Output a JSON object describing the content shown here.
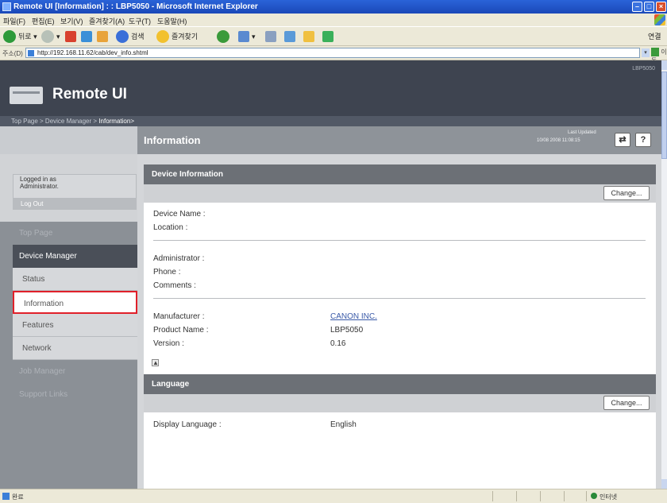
{
  "browser": {
    "title": "Remote UI [Information] : : LBP5050 - Microsoft Internet Explorer",
    "menu": [
      "파일(F)",
      "편집(E)",
      "보기(V)",
      "즐겨찾기(A)",
      "도구(T)",
      "도움말(H)"
    ],
    "toolbar": {
      "back_label": "뒤로",
      "search_label": "검색",
      "favorites_label": "즐겨찾기",
      "links_label": "연결"
    },
    "address_label": "주소(D)",
    "address_url": "http://192.168.11.62/cab/dev_info.shtml",
    "go_label": "이동",
    "status_left": "완료",
    "status_zone": "인터넷"
  },
  "header": {
    "logo": "Remote UI",
    "model": "LBP5050"
  },
  "breadcrumb": {
    "path": "Top Page > Device Manager > ",
    "current": "Information>"
  },
  "page": {
    "title": "Information",
    "last_updated_label": "Last Updated",
    "last_updated_time": "10/08 2008 11:08:15"
  },
  "sidebar": {
    "logged_in_line1": "Logged in as",
    "logged_in_line2": "Administrator.",
    "logout": "Log Out",
    "items": [
      {
        "label": "Top Page"
      },
      {
        "label": "Device Manager"
      },
      {
        "label": "Status"
      },
      {
        "label": "Information"
      },
      {
        "label": "Features"
      },
      {
        "label": "Network"
      },
      {
        "label": "Job Manager"
      },
      {
        "label": "Support Links"
      }
    ]
  },
  "device_info": {
    "heading": "Device Information",
    "change": "Change...",
    "device_name_label": "Device Name :",
    "location_label": "Location :",
    "administrator_label": "Administrator :",
    "phone_label": "Phone :",
    "comments_label": "Comments :",
    "manufacturer_label": "Manufacturer :",
    "manufacturer_value": "CANON INC.",
    "product_name_label": "Product Name :",
    "product_name_value": "LBP5050",
    "version_label": "Version :",
    "version_value": "0.16",
    "collapse_glyph": "▲"
  },
  "language": {
    "heading": "Language",
    "change": "Change...",
    "display_language_label": "Display Language :",
    "display_language_value": "English"
  },
  "buttons": {
    "refresh_glyph": "⇄",
    "help_glyph": "?"
  },
  "colors": {
    "header_bg": "#3e4450",
    "section_head_bg": "#6c7076",
    "selected_outline": "#e0202a",
    "link": "#3a5aa8"
  }
}
